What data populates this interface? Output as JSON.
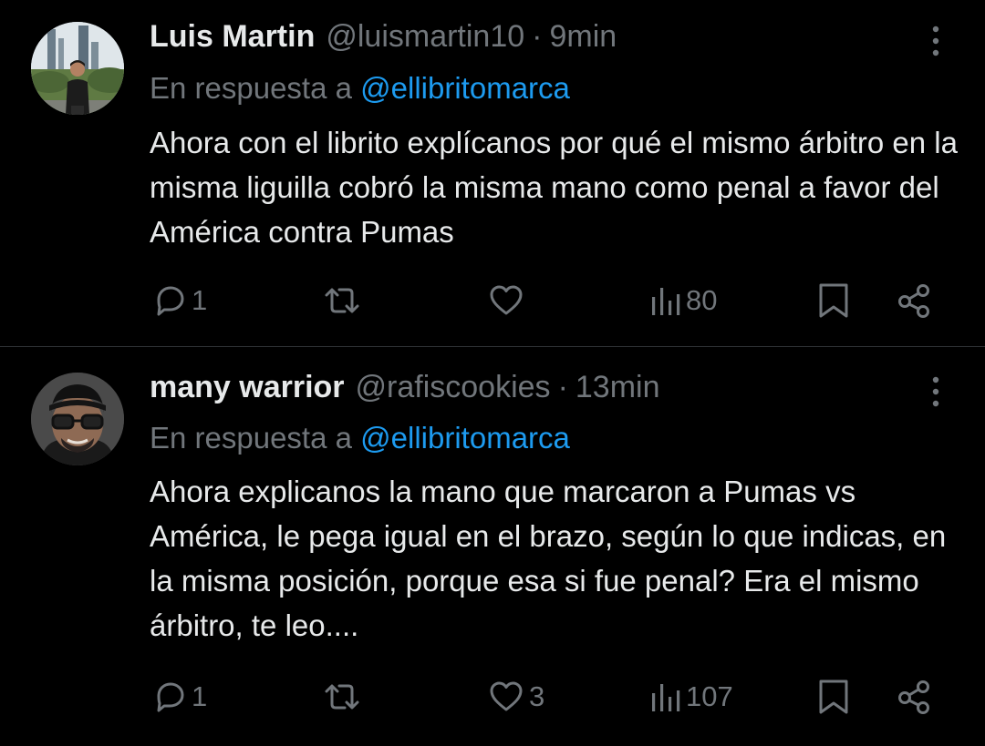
{
  "colors": {
    "background": "#000000",
    "text_primary": "#e7e9ea",
    "text_secondary": "#71767b",
    "mention": "#1d9bf0",
    "divider": "#2f3336"
  },
  "tweets": [
    {
      "name": "Luis Martin",
      "handle": "@luismartin10",
      "separator": "·",
      "time": "9min",
      "reply_prefix": "En respuesta a",
      "reply_to": "@ellibritomarca",
      "text": "Ahora con el librito explícanos por qué el mismo árbitro en la misma liguilla cobró la misma mano como penal a favor del América contra Pumas",
      "replies": "1",
      "retweets": "",
      "likes": "",
      "views": "80",
      "avatar_icon": "avatar-photo",
      "more_icon": "more-vertical-icon"
    },
    {
      "name": "many warrior",
      "handle": "@rafiscookies",
      "separator": "·",
      "time": "13min",
      "reply_prefix": "En respuesta a",
      "reply_to": "@ellibritomarca",
      "text": "Ahora explicanos la mano que marcaron a Pumas vs América, le pega igual en el brazo, según lo que indicas, en la misma posición, porque esa si fue penal? Era el mismo árbitro, te leo....",
      "replies": "1",
      "retweets": "",
      "likes": "3",
      "views": "107",
      "avatar_icon": "avatar-photo",
      "more_icon": "more-vertical-icon"
    }
  ],
  "action_icons": [
    "reply-icon",
    "retweet-icon",
    "like-icon",
    "views-icon",
    "bookmark-icon",
    "share-icon"
  ]
}
